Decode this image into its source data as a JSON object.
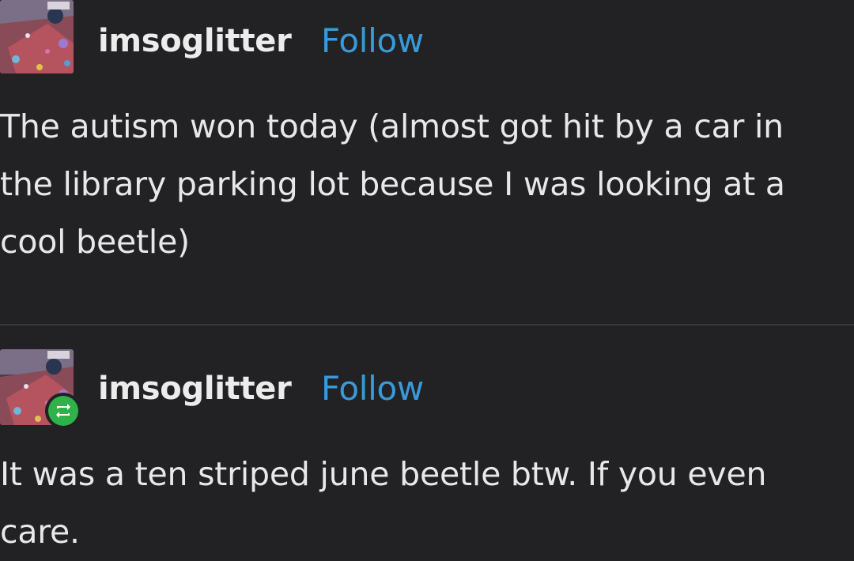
{
  "posts": [
    {
      "username": "imsoglitter",
      "follow_label": "Follow",
      "avatar_icon": "glitter-avatar",
      "body_lines": [
        "The autism won today (almost got hit by a car in",
        "the library parking lot because I was looking at a",
        "cool beetle)"
      ]
    },
    {
      "username": "imsoglitter",
      "follow_label": "Follow",
      "avatar_icon": "glitter-avatar",
      "badge_icon": "reblog-icon",
      "body_lines": [
        "It was a ten striped june beetle btw. If you even",
        "care."
      ]
    }
  ],
  "colors": {
    "background": "#222124",
    "follow_link": "#3a9ad9",
    "reblog_badge": "#2fb24a",
    "text": "#e8e8e8"
  }
}
